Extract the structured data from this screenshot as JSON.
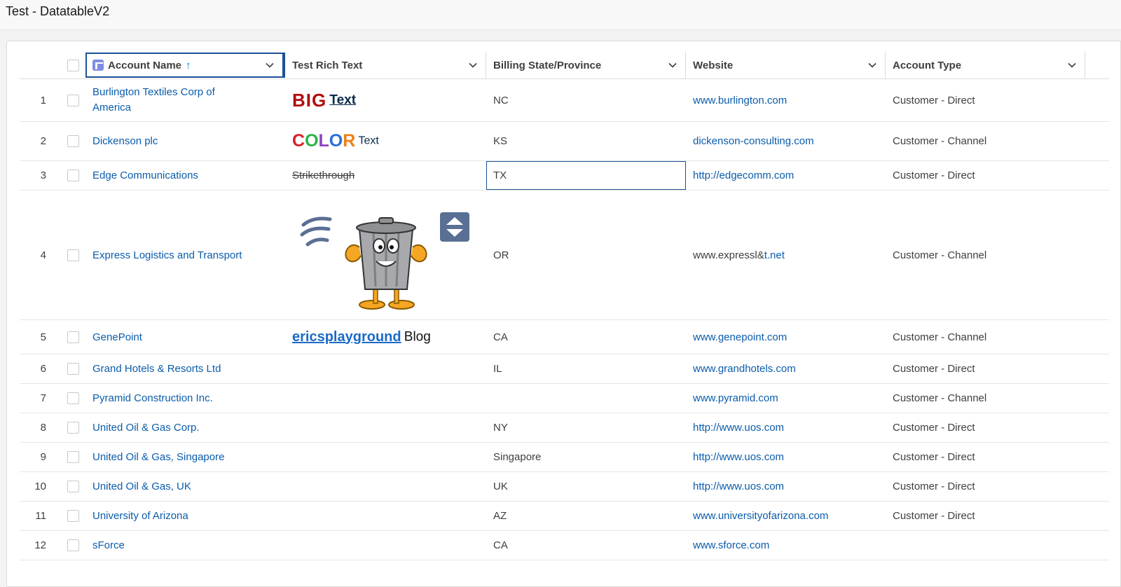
{
  "page": {
    "title": "Test - DatatableV2"
  },
  "columns": [
    {
      "label": "Account Name",
      "sorted": "ascending"
    },
    {
      "label": "Test Rich Text"
    },
    {
      "label": "Billing State/Province"
    },
    {
      "label": "Website"
    },
    {
      "label": "Account Type"
    }
  ],
  "sort_arrow": "↑",
  "rich": {
    "r1_big": "BIG",
    "r1_text": "Text",
    "r2_letters": [
      "C",
      "O",
      "L",
      "O",
      "R"
    ],
    "r2_colors": [
      "#d8232a",
      "#2db34a",
      "#8e44c0",
      "#2a6fd6",
      "#f07f16"
    ],
    "r2_text": "Text",
    "r3_strike": "Strikethrough",
    "r5_link": "ericsplayground",
    "r5_text": "Blog"
  },
  "colors": {
    "link": "#0b5cab",
    "focus_border": "#1b5297",
    "icon_slate": "#5a6f94"
  },
  "rows": [
    {
      "num": "1",
      "name": "Burlington Textiles Corp of America",
      "state": "NC",
      "website": "www.burlington.com",
      "type": "Customer - Direct"
    },
    {
      "num": "2",
      "name": "Dickenson plc",
      "state": "KS",
      "website": "dickenson-consulting.com",
      "type": "Customer - Channel"
    },
    {
      "num": "3",
      "name": "Edge Communications",
      "state": "TX",
      "website": "http://edgecomm.com",
      "type": "Customer - Direct"
    },
    {
      "num": "4",
      "name": "Express Logistics and Transport",
      "state": "OR",
      "website_pre": "www.expressl&",
      "website_link": "t.net",
      "type": "Customer - Channel"
    },
    {
      "num": "5",
      "name": "GenePoint",
      "state": "CA",
      "website": "www.genepoint.com",
      "type": "Customer - Channel"
    },
    {
      "num": "6",
      "name": "Grand Hotels & Resorts Ltd",
      "state": "IL",
      "website": "www.grandhotels.com",
      "type": "Customer - Direct"
    },
    {
      "num": "7",
      "name": "Pyramid Construction Inc.",
      "state": "",
      "website": "www.pyramid.com",
      "type": "Customer - Channel"
    },
    {
      "num": "8",
      "name": "United Oil & Gas Corp.",
      "state": "NY",
      "website": "http://www.uos.com",
      "type": "Customer - Direct"
    },
    {
      "num": "9",
      "name": "United Oil & Gas, Singapore",
      "state": "Singapore",
      "website": "http://www.uos.com",
      "type": "Customer - Direct"
    },
    {
      "num": "10",
      "name": "United Oil & Gas, UK",
      "state": "UK",
      "website": "http://www.uos.com",
      "type": "Customer - Direct"
    },
    {
      "num": "11",
      "name": "University of Arizona",
      "state": "AZ",
      "website": "www.universityofarizona.com",
      "type": "Customer - Direct"
    },
    {
      "num": "12",
      "name": "sForce",
      "state": "CA",
      "website": "www.sforce.com",
      "type": ""
    }
  ]
}
